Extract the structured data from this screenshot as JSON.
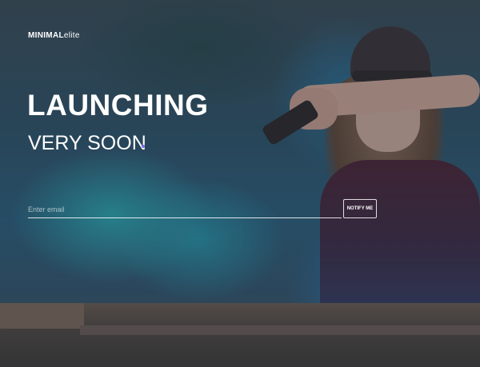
{
  "brand": {
    "bold": "MINIMAL",
    "light": "elite"
  },
  "hero": {
    "headline": "LAUNCHING",
    "subhead": "VERY SOON"
  },
  "signup": {
    "placeholder": "Enter email",
    "button_label": "NOTIFY ME"
  },
  "colors": {
    "accent_dot": "#7c6cf0",
    "smoke": "#2da5af"
  }
}
